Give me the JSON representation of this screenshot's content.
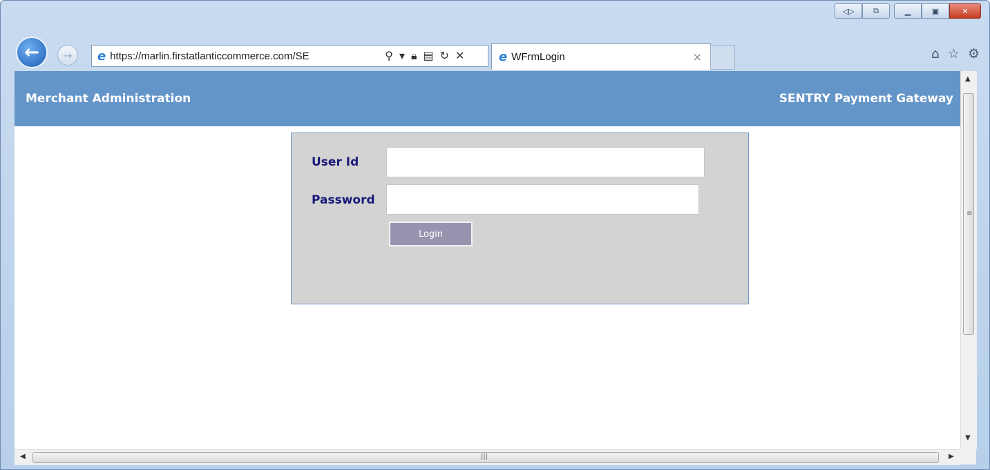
{
  "browser": {
    "url": "https://marlin.firstatlanticcommerce.com/SE",
    "tab_title": "WFrmLogin",
    "tab_close_glyph": "×",
    "back_glyph": "🡐",
    "forward_glyph": "➔",
    "icons": [
      "ie-logo-icon",
      "search-icon",
      "dropdown-icon",
      "lock-icon",
      "compat-view-icon",
      "refresh-icon",
      "stop-icon",
      "home-icon",
      "favorites-star-icon",
      "gear-icon"
    ]
  },
  "header": {
    "left_title": "Merchant Administration",
    "right_title": "SENTRY Payment Gateway"
  },
  "login_form": {
    "user_id_label": "User Id",
    "user_id_value": "",
    "password_label": "Password",
    "password_value": "",
    "login_button_label": "Login"
  },
  "colors": {
    "header_bg": "#6495c9",
    "panel_bg": "#d3d3d3",
    "label_color": "#1a1a7a",
    "button_bg": "#9a93b0"
  }
}
